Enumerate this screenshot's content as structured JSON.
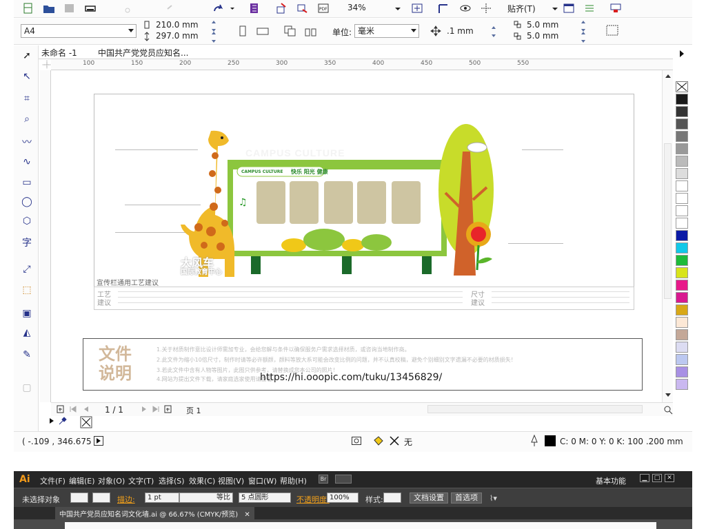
{
  "corel": {
    "zoom": "34%",
    "snap_label": "贴齐(T)",
    "page_size": "A4",
    "width": "210.0 mm",
    "height": "297.0 mm",
    "units_label": "单位:",
    "units_value": "毫米",
    "nudge": ".1 mm",
    "dup_x": "5.0 mm",
    "dup_y": "5.0 mm",
    "tabs": [
      "未命名 -1",
      "中国共产党党员应知名..."
    ],
    "ruler_marks": [
      "100",
      "150",
      "200",
      "250",
      "300",
      "350",
      "400",
      "450",
      "500",
      "550"
    ],
    "page_nav": "1 / 1",
    "page_tab": "页 1",
    "coords": "( -.109 , 346.675 )",
    "fill_none": "无",
    "outline_info": "C: 0 M: 0 Y: 0 K: 100  .200 mm"
  },
  "artwork": {
    "campus_culture": "CAMPUS CULTURE",
    "panel_tag": "CAMPUS CULTURE",
    "panel_slogan": "快乐 阳光 健康",
    "logo_line1": "大风车",
    "logo_line2": "国际教育中心",
    "process_title": "宣传栏通用工艺建议",
    "process_label": "工艺建议",
    "size_label": "尺寸建议",
    "file_notes_title": "文件说明",
    "file_notes": [
      "1.关于材质制作意比设计师需加专业，会给您解与条件以确保服务户需求选择材质，或咨询当地制作商。",
      "2.此文件为缩小10倍尺寸，制作时请等必许额颜，颜料等放大系可能会改变比例的问题，并不认真校稿，避免个别细别文字遗漏不必要的材质损失！",
      "3.若此文件中含有人物等图片，此图只供参考，请替换成您本公司的照片！",
      "4.网站为提出文件下载，请家庭选家使用请查看"
    ],
    "url": "https://hi.ooopic.com/tuku/13456829/"
  },
  "illustrator": {
    "logo": "Ai",
    "menu": [
      "文件(F)",
      "编辑(E)",
      "对象(O)",
      "文字(T)",
      "选择(S)",
      "效果(C)",
      "视图(V)",
      "窗口(W)",
      "帮助(H)"
    ],
    "workspace": "基本功能",
    "no_selection": "未选择对象",
    "stroke_label": "描边:",
    "stroke_value": "1 pt",
    "stroke_style": "等比",
    "brush": "5 点圆形",
    "opacity_label": "不透明度:",
    "opacity_value": "100%",
    "style_label": "样式:",
    "doc_setup": "文档设置",
    "prefs": "首选项",
    "doc_tab": "中国共产党员应知名词文化墙.ai @ 66.67% (CMYK/预览)"
  },
  "palette": [
    "#1a1a1a",
    "#333333",
    "#555555",
    "#777777",
    "#999999",
    "#bbbbbb",
    "#dddddd",
    "#ffffff",
    "#ffffff",
    "#ffffff",
    "#ffffff",
    "#0a1aa6",
    "#12c8e8",
    "#1dbb3a",
    "#d8e41a",
    "#e8198a",
    "#d81a8f",
    "#d8a817",
    "#fce8d6",
    "#c4a898",
    "#dcdcf2",
    "#bcc8f0",
    "#a890e4",
    "#cab8f0"
  ],
  "colors": {
    "giraffe": "#f0ba2a",
    "giraffe_spot": "#d06a1a",
    "board_green": "#8cc63e",
    "post_green": "#1b6a2a",
    "tree_trunk": "#d0622a",
    "tree_crown": "#c8dc2a",
    "flower": "#e8252a",
    "card": "#cec5a2"
  }
}
